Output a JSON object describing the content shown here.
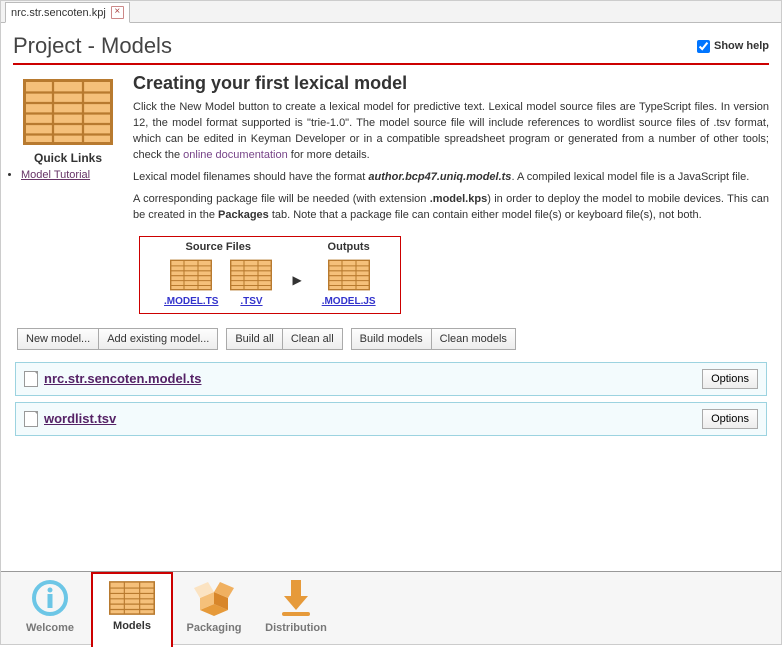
{
  "fileTab": {
    "label": "nrc.str.sencoten.kpj"
  },
  "header": {
    "title": "Project - Models",
    "showHelpLabel": "Show help"
  },
  "sidebar": {
    "quickLinksTitle": "Quick Links",
    "links": [
      "Model Tutorial"
    ]
  },
  "help": {
    "heading": "Creating your first lexical model",
    "p1a": "Click the New Model button to create a lexical model for predictive text. Lexical model source files are TypeScript files. In version 12, the model format supported is \"trie-1.0\". The model source file will include references to wordlist source files of .tsv format, which can be edited in Keyman Developer or in a compatible spreadsheet program or generated from a number of other tools; check the ",
    "p1link": "online documentation",
    "p1b": " for more details.",
    "p2a": "Lexical model filenames should have the format ",
    "p2fmt": "author.bcp47.uniq.model.ts",
    "p2b": ". A compiled lexical model file is a JavaScript file.",
    "p3a": "A corresponding package file will be needed (with extension ",
    "p3ext": ".model.kps",
    "p3b": ") in order to deploy the model to mobile devices. This can be created in the ",
    "p3tab": "Packages",
    "p3c": " tab. Note that a package file can contain either model file(s) or keyboard file(s), not both."
  },
  "diagram": {
    "srcTitle": "Source Files",
    "outTitle": "Outputs",
    "srcItems": [
      ".MODEL.TS",
      ".TSV"
    ],
    "outItems": [
      ".MODEL.JS"
    ]
  },
  "toolbar": {
    "g1": [
      "New model...",
      "Add existing model..."
    ],
    "g2": [
      "Build all",
      "Clean all"
    ],
    "g3": [
      "Build models",
      "Clean models"
    ]
  },
  "files": {
    "items": [
      {
        "name": "nrc.str.sencoten.model.ts",
        "options": "Options"
      },
      {
        "name": "wordlist.tsv",
        "options": "Options"
      }
    ]
  },
  "bottomNav": {
    "items": [
      "Welcome",
      "Models",
      "Packaging",
      "Distribution"
    ],
    "activeIndex": 1
  }
}
